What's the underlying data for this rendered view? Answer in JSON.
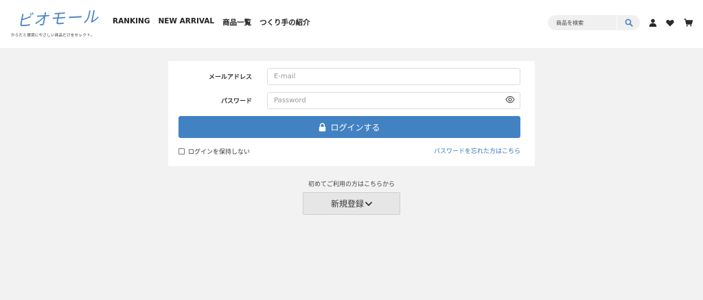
{
  "header": {
    "logo_text": "ビオモール",
    "tagline": "からだと環境にやさしい商品だけをセレクト。",
    "nav": [
      "RANKING",
      "NEW ARRIVAL",
      "商品一覧",
      "つくり手の紹介"
    ],
    "search_placeholder": "商品を検索",
    "icons": [
      "search-icon",
      "user-icon",
      "heart-icon",
      "cart-icon"
    ]
  },
  "login": {
    "email_label": "メールアドレス",
    "email_placeholder": "E-mail",
    "password_label": "パスワード",
    "password_placeholder": "Password",
    "login_button": "ログインする",
    "remember_label": "ログインを保持しない",
    "forgot_link": "パスワードを忘れた方はこちら"
  },
  "register": {
    "first_time_text": "初めてご利用の方はこちらから",
    "register_button": "新規登録"
  },
  "colors": {
    "accent": "#4282c3",
    "link": "#3a78b9",
    "page_bg": "#f2f2f2"
  }
}
